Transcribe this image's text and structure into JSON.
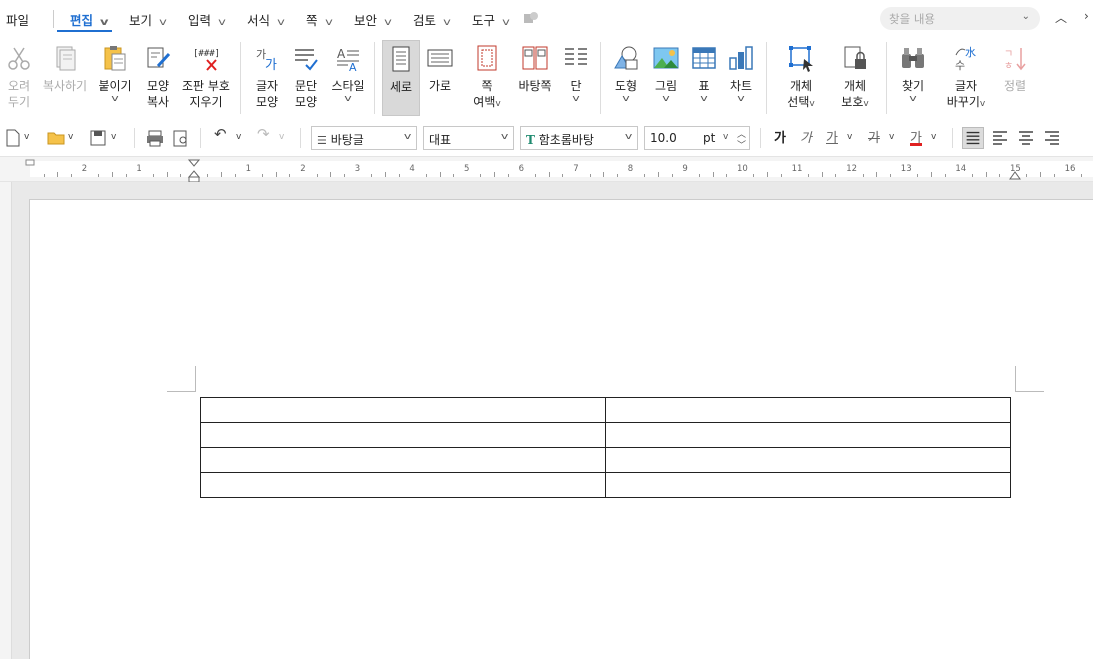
{
  "menu": {
    "file": "파일",
    "items": [
      {
        "label": "편집",
        "active": true
      },
      {
        "label": "보기"
      },
      {
        "label": "입력"
      },
      {
        "label": "서식"
      },
      {
        "label": "쪽"
      },
      {
        "label": "보안"
      },
      {
        "label": "검토"
      },
      {
        "label": "도구"
      }
    ],
    "search_placeholder": "찾을 내용"
  },
  "ribbon": {
    "cut": [
      "오려",
      "두기"
    ],
    "copy": "복사하기",
    "paste": "붙이기",
    "format_copy": [
      "모양",
      "복사"
    ],
    "clear_marks": [
      "조판 부호",
      "지우기"
    ],
    "char_shape": [
      "글자",
      "모양"
    ],
    "para_shape": [
      "문단",
      "모양"
    ],
    "style": "스타일",
    "portrait": "세로",
    "landscape": "가로",
    "page_margin": [
      "쪽",
      "여백"
    ],
    "background_page": "바탕쪽",
    "columns": "단",
    "shapes": "도형",
    "picture": "그림",
    "table": "표",
    "chart": "차트",
    "object_select": [
      "개체",
      "선택"
    ],
    "object_protect": [
      "개체",
      "보호"
    ],
    "find": "찾기",
    "replace": [
      "글자",
      "바꾸기"
    ],
    "sort": "정렬"
  },
  "toolbar": {
    "style_value": "바탕글",
    "lang_value": "대표",
    "font_value": "함초롬바탕",
    "size_value": "10.0",
    "size_unit": "pt",
    "bold_glyph": "가",
    "italic_glyph": "가",
    "underline_glyph": "가",
    "strike_glyph": "가",
    "color_glyph": "가"
  },
  "ruler": {
    "numbers": [
      "2",
      "1",
      "1",
      "2",
      "3",
      "4",
      "5",
      "6",
      "7",
      "8",
      "9",
      "10",
      "11",
      "12",
      "13",
      "14",
      "15",
      "16"
    ]
  },
  "document": {
    "table_rows": [
      [
        "",
        ""
      ],
      [
        "",
        ""
      ],
      [
        "",
        ""
      ],
      [
        "",
        ""
      ]
    ]
  },
  "colors": {
    "accent": "#1f6fd1",
    "text_color_bar": "#e02020"
  }
}
